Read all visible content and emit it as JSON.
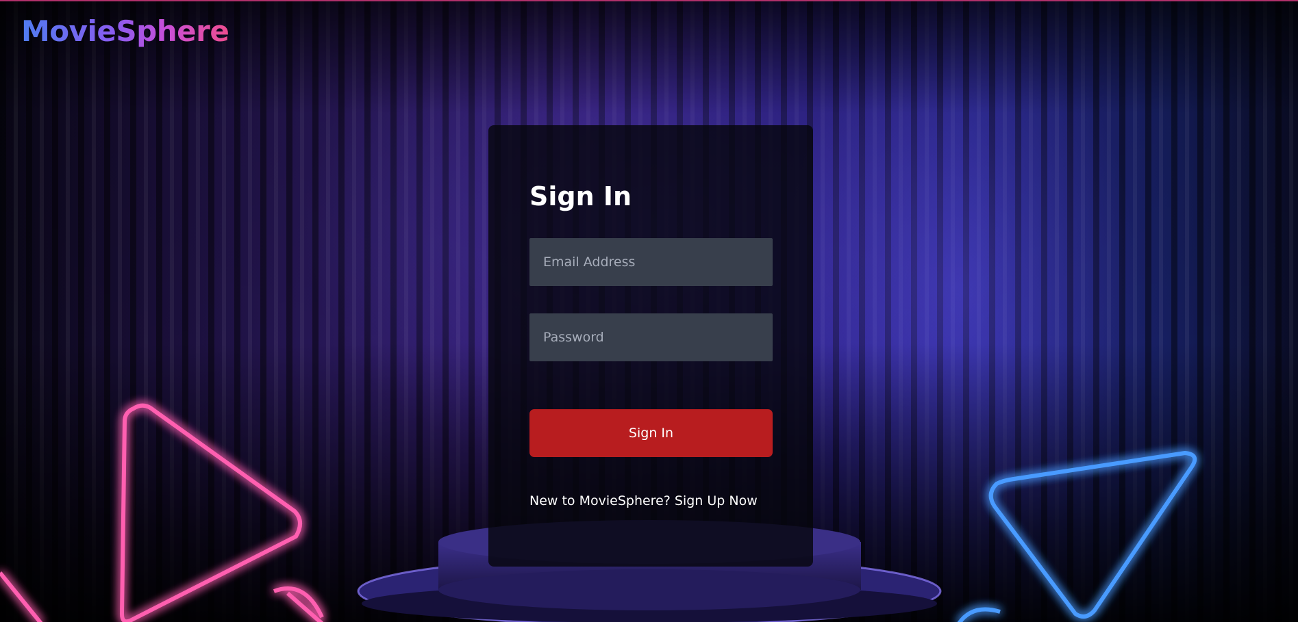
{
  "brand": {
    "logo_text": "MovieSphere",
    "gradient": [
      "#4f7cf0",
      "#8a5cf0",
      "#c84fd8",
      "#ee4d8f"
    ]
  },
  "signin": {
    "title": "Sign In",
    "email_placeholder": "Email Address",
    "password_placeholder": "Password",
    "submit_label": "Sign In",
    "signup_prompt": "New to MovieSphere?",
    "signup_link": "Sign Up Now",
    "button_color": "#b81d1f",
    "field_color": "#383f4c"
  },
  "background": {
    "icons": [
      "neon-triangle-pink-icon",
      "neon-triangle-blue-icon",
      "stage-pedestal-icon",
      "curtain-backdrop-icon"
    ],
    "neon_pink": "#ff3f9e",
    "neon_blue": "#3f8cff",
    "curtain": "#2a1a6a"
  }
}
